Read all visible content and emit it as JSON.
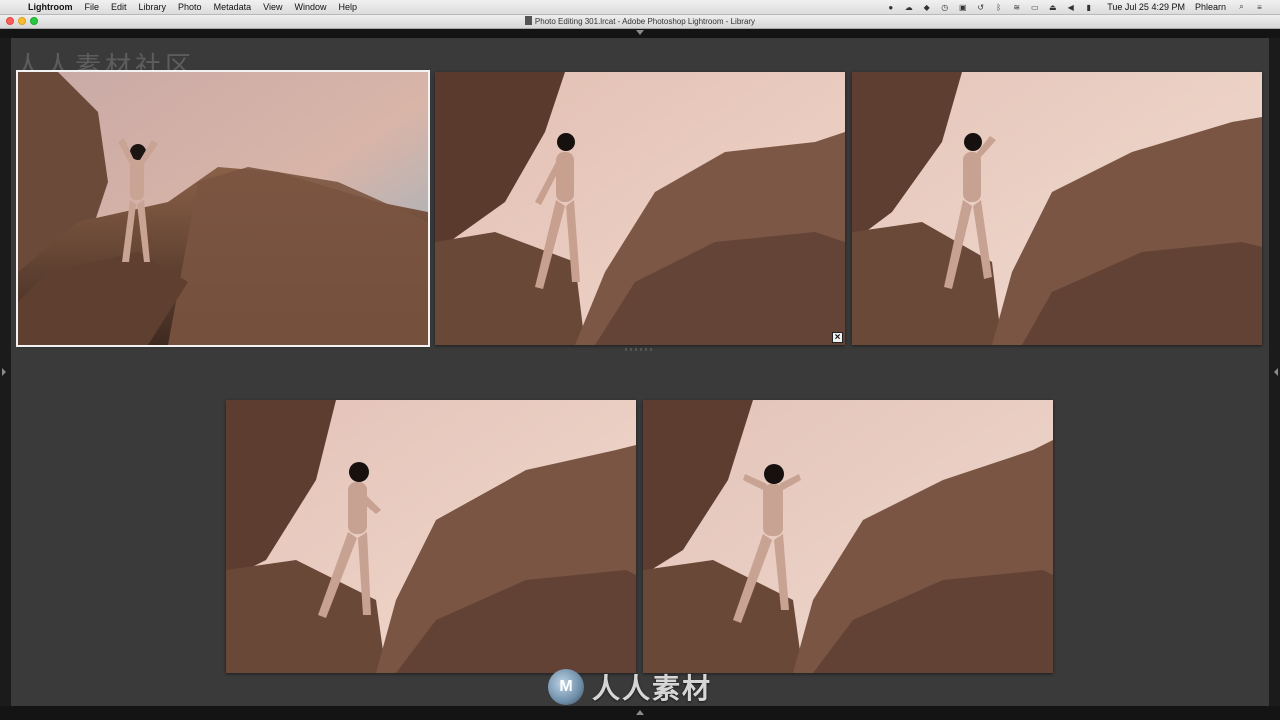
{
  "menubar": {
    "apple": "",
    "app": "Lightroom",
    "items": [
      "File",
      "Edit",
      "Library",
      "Photo",
      "Metadata",
      "View",
      "Window",
      "Help"
    ],
    "clock": "Tue Jul 25  4:29 PM",
    "user": "Phlearn"
  },
  "window": {
    "title": "Photo Editing 301.lrcat - Adobe Photoshop Lightroom - Library"
  },
  "survey": {
    "close_label": "×"
  },
  "watermarks": {
    "top": "人人素材社区",
    "logo_text": "人人素材",
    "logo_mark": "M"
  },
  "colors": {
    "panel_bg": "#3a3a3a",
    "selection_outline": "#f2f2f2"
  }
}
